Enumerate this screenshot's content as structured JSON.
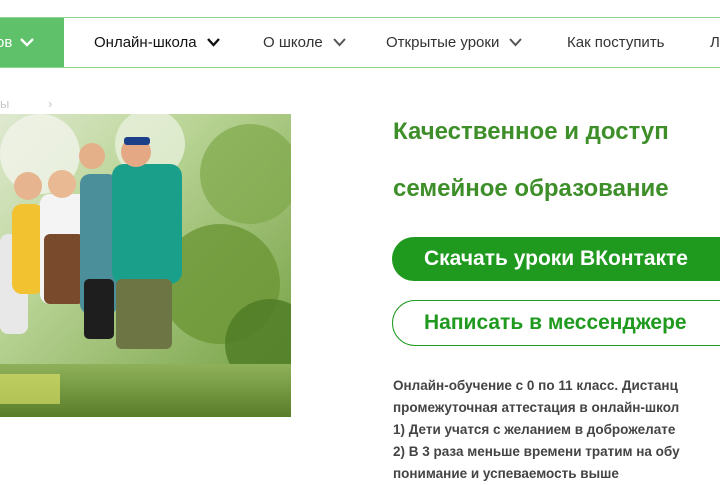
{
  "nav": {
    "active_partial": "ов",
    "items": [
      {
        "label": "Онлайн-школа"
      },
      {
        "label": "О школе"
      },
      {
        "label": "Открытые уроки"
      },
      {
        "label": "Как поступить"
      },
      {
        "label": "Л"
      }
    ]
  },
  "breadcrumb": {
    "partial": "ы",
    "separator": "›"
  },
  "hero": {
    "heading_line1": "Качественное и доступ",
    "heading_line2": "семейное образование",
    "primary_button": "Скачать уроки ВКонтакте",
    "secondary_button": "Написать в мессенджере",
    "description": [
      "Онлайн-обучение с 0 по 11 класс. Дистанц",
      "промежуточная аттестация в онлайн-школ",
      "1) Дети учатся с желанием в доброжелате",
      "2) В 3 раза меньше времени тратим на обу",
      "понимание и успеваемость выше"
    ]
  },
  "colors": {
    "accent_green": "#1f9a1f",
    "heading_green": "#3e8f2a",
    "nav_active": "#5fc26a"
  },
  "icons": {
    "chevron": "chevron-down-icon",
    "breadcrumb_arrow": "chevron-right-icon"
  }
}
